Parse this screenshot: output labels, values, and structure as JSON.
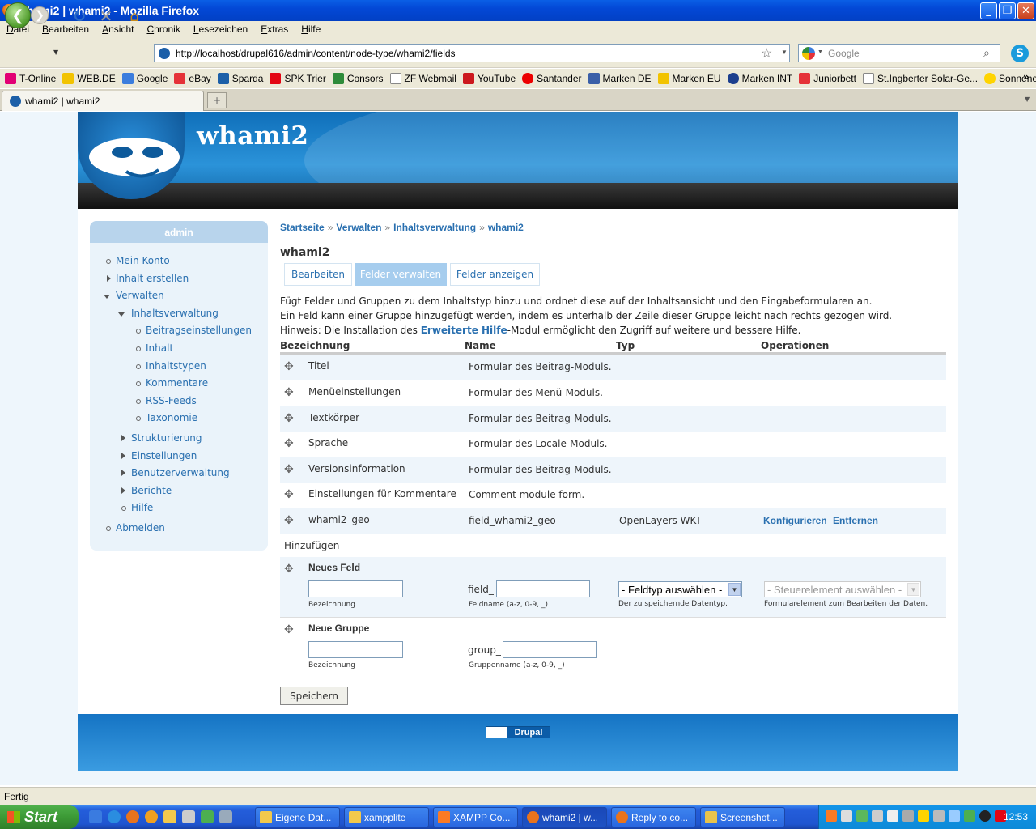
{
  "window": {
    "title": "whami2 | whami2 - Mozilla Firefox"
  },
  "menu": [
    "Datei",
    "Bearbeiten",
    "Ansicht",
    "Chronik",
    "Lesezeichen",
    "Extras",
    "Hilfe"
  ],
  "url": "http://localhost/drupal616/admin/content/node-type/whami2/fields",
  "search": {
    "placeholder": "Google"
  },
  "bookmarks": [
    {
      "label": "T-Online",
      "color": "#e20074"
    },
    {
      "label": "WEB.DE",
      "color": "#f2c300"
    },
    {
      "label": "Google",
      "color": "#3b7ddd"
    },
    {
      "label": "eBay",
      "color": "#e53238"
    },
    {
      "label": "Sparda",
      "color": "#1c5fa8"
    },
    {
      "label": "SPK Trier",
      "color": "#e30613"
    },
    {
      "label": "Consors",
      "color": "#2e8b3a"
    },
    {
      "label": "ZF Webmail",
      "color": "#ffffff"
    },
    {
      "label": "YouTube",
      "color": "#cc181e"
    },
    {
      "label": "Santander",
      "color": "#ec0000"
    },
    {
      "label": "Marken DE",
      "color": "#3a5fa8"
    },
    {
      "label": "Marken EU",
      "color": "#f2c300"
    },
    {
      "label": "Marken INT",
      "color": "#1c3f8e"
    },
    {
      "label": "Juniorbett",
      "color": "#e53238"
    },
    {
      "label": "St.Ingberter Solar-Ge...",
      "color": "#ffffff"
    },
    {
      "label": "Sonnenertrag.eu",
      "color": "#ffd400"
    }
  ],
  "tab": {
    "label": "whami2 | whami2"
  },
  "site": {
    "name": "whami2"
  },
  "sidebar": {
    "title": "admin",
    "items": [
      {
        "label": "Mein Konto"
      },
      {
        "label": "Inhalt erstellen"
      },
      {
        "label": "Verwalten"
      },
      {
        "label": "Inhaltsverwaltung"
      },
      {
        "label": "Beitragseinstellungen"
      },
      {
        "label": "Inhalt"
      },
      {
        "label": "Inhaltstypen"
      },
      {
        "label": "Kommentare"
      },
      {
        "label": "RSS-Feeds"
      },
      {
        "label": "Taxonomie"
      },
      {
        "label": "Strukturierung"
      },
      {
        "label": "Einstellungen"
      },
      {
        "label": "Benutzerverwaltung"
      },
      {
        "label": "Berichte"
      },
      {
        "label": "Hilfe"
      },
      {
        "label": "Abmelden"
      }
    ]
  },
  "breadcrumb": [
    "Startseite",
    "Verwalten",
    "Inhaltsverwaltung",
    "whami2"
  ],
  "breadcrumb_sep": "»",
  "page_title": "whami2",
  "tabs": [
    {
      "label": "Bearbeiten",
      "active": false
    },
    {
      "label": "Felder verwalten",
      "active": true
    },
    {
      "label": "Felder anzeigen",
      "active": false
    }
  ],
  "help": {
    "line1": "Fügt Felder und Gruppen zu dem Inhaltstyp hinzu und ordnet diese auf der Inhaltsansicht und den Eingabeformularen an.",
    "line2": "Ein Feld kann einer Gruppe hinzugefügt werden, indem es unterhalb der Zeile dieser Gruppe leicht nach rechts gezogen wird.",
    "line3_pre": "Hinweis: Die Installation des ",
    "line3_link": "Erweiterte Hilfe",
    "line3_post": "-Modul ermöglicht den Zugriff auf weitere und bessere Hilfe."
  },
  "table": {
    "headers": [
      "Bezeichnung",
      "Name",
      "Typ",
      "Operationen"
    ],
    "rows": [
      {
        "label": "Titel",
        "name": "Formular des Beitrag-Moduls.",
        "type": "",
        "ops": []
      },
      {
        "label": "Menüeinstellungen",
        "name": "Formular des Menü-Moduls.",
        "type": "",
        "ops": []
      },
      {
        "label": "Textkörper",
        "name": "Formular des Beitrag-Moduls.",
        "type": "",
        "ops": []
      },
      {
        "label": "Sprache",
        "name": "Formular des Locale-Moduls.",
        "type": "",
        "ops": []
      },
      {
        "label": "Versionsinformation",
        "name": "Formular des Beitrag-Moduls.",
        "type": "",
        "ops": []
      },
      {
        "label": "Einstellungen für Kommentare",
        "name": "Comment module form.",
        "type": "",
        "ops": []
      },
      {
        "label": "whami2_geo",
        "name": "field_whami2_geo",
        "type": "OpenLayers WKT",
        "ops": [
          "Konfigurieren",
          "Entfernen"
        ]
      }
    ],
    "add_label": "Hinzufügen",
    "new_field": {
      "title": "Neues Feld",
      "label_hint": "Bezeichnung",
      "name_prefix": "field_",
      "name_hint": "Feldname (a-z, 0-9, _)",
      "type_select": "- Feldtyp auswählen -",
      "type_hint": "Der zu speichernde Datentyp.",
      "widget_select": "- Steuerelement auswählen -",
      "widget_hint": "Formularelement zum Bearbeiten der Daten."
    },
    "new_group": {
      "title": "Neue Gruppe",
      "label_hint": "Bezeichnung",
      "name_prefix": "group_",
      "name_hint": "Gruppenname (a-z, 0-9, _)"
    }
  },
  "save_button": "Speichern",
  "footer": {
    "badge": "Drupal"
  },
  "status": "Fertig",
  "taskbar": {
    "start": "Start",
    "tasks": [
      {
        "label": "Eigene Dat...",
        "active": false,
        "color": "#f2c94c"
      },
      {
        "label": "xampplite",
        "active": false,
        "color": "#f2c94c"
      },
      {
        "label": "XAMPP Co...",
        "active": false,
        "color": "#fb7a24"
      },
      {
        "label": "whami2 | w...",
        "active": true,
        "color": "#e8731c"
      },
      {
        "label": "Reply to co...",
        "active": false,
        "color": "#e8731c"
      },
      {
        "label": "Screenshot...",
        "active": false,
        "color": "#e8c34c"
      }
    ],
    "clock": "12:53"
  }
}
